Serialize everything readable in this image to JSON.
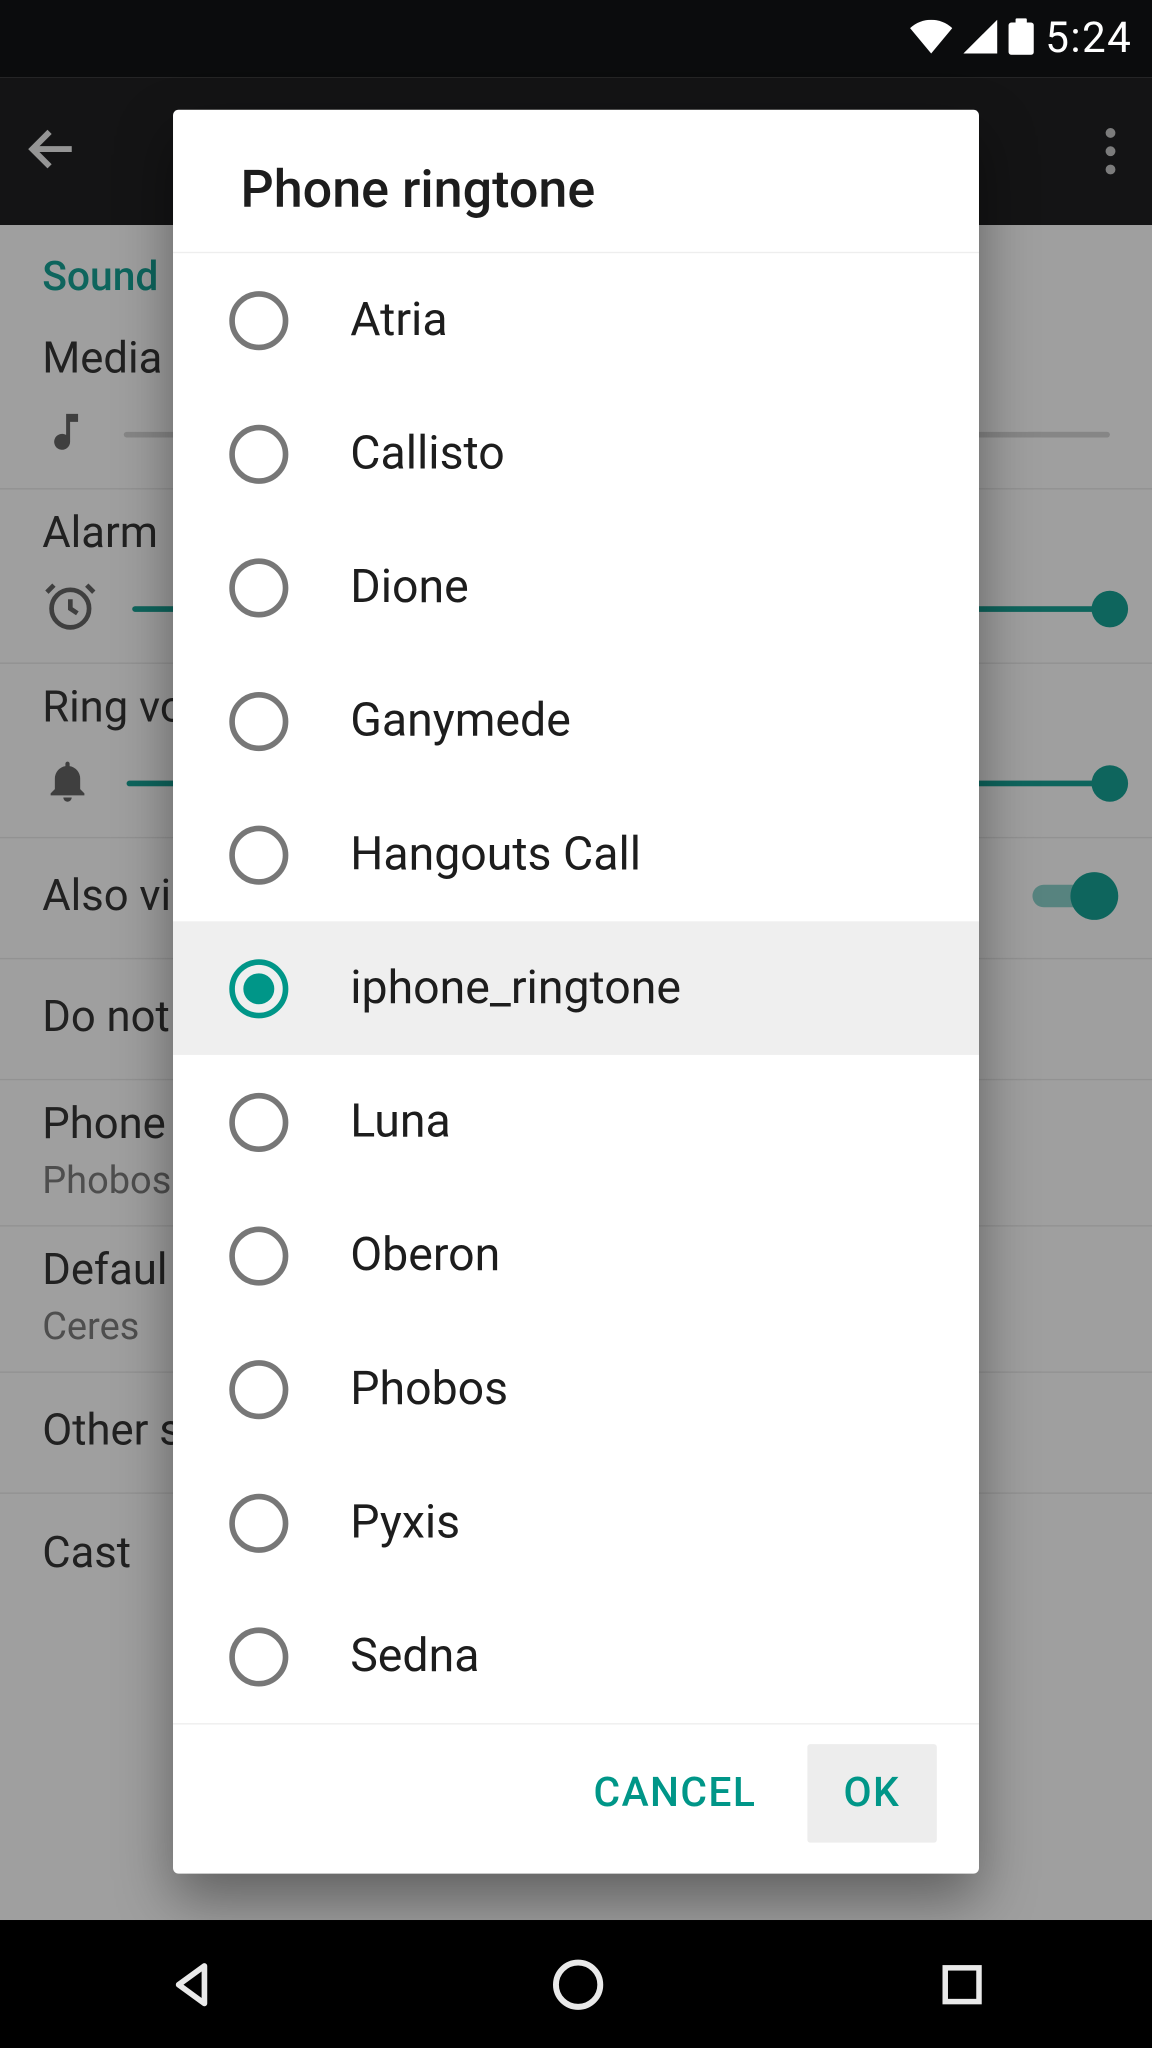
{
  "status": {
    "time": "5:24"
  },
  "settings": {
    "section": "Sound",
    "media_label": "Media",
    "alarm_label": "Alarm",
    "ring_label": "Ring vo",
    "also_vibrate": "Also vi",
    "dnd": "Do not",
    "phone_ringtone_title": "Phone",
    "phone_ringtone_value": "Phobos",
    "default_notif_title": "Defaul",
    "default_notif_value": "Ceres",
    "other_sounds": "Other s",
    "cast": "Cast"
  },
  "dialog": {
    "title": "Phone ringtone",
    "options": [
      {
        "label": "Atria",
        "selected": false
      },
      {
        "label": "Callisto",
        "selected": false
      },
      {
        "label": "Dione",
        "selected": false
      },
      {
        "label": "Ganymede",
        "selected": false
      },
      {
        "label": "Hangouts Call",
        "selected": false
      },
      {
        "label": "iphone_ringtone",
        "selected": true
      },
      {
        "label": "Luna",
        "selected": false
      },
      {
        "label": "Oberon",
        "selected": false
      },
      {
        "label": "Phobos",
        "selected": false
      },
      {
        "label": "Pyxis",
        "selected": false
      },
      {
        "label": "Sedna",
        "selected": false
      }
    ],
    "cancel": "CANCEL",
    "ok": "OK"
  },
  "colors": {
    "accent": "#009688"
  }
}
